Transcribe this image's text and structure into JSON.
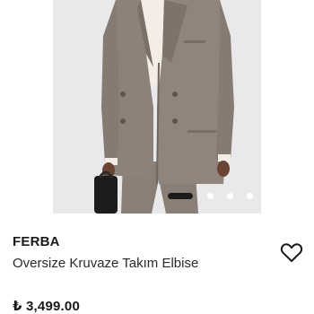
{
  "product": {
    "brand": "FERBA",
    "name": "Oversize Kruvaze Takım Elbise",
    "price": "₺ 3,499.00",
    "favorite_icon": "heart-outline-icon"
  },
  "gallery": {
    "image_subject": "model-in-oversize-double-breasted-suit",
    "total_images": 4,
    "active_index": 0
  },
  "colors": {
    "suit": "#8b8179",
    "background": "#e9e9eb",
    "text": "#1a1a1a"
  }
}
